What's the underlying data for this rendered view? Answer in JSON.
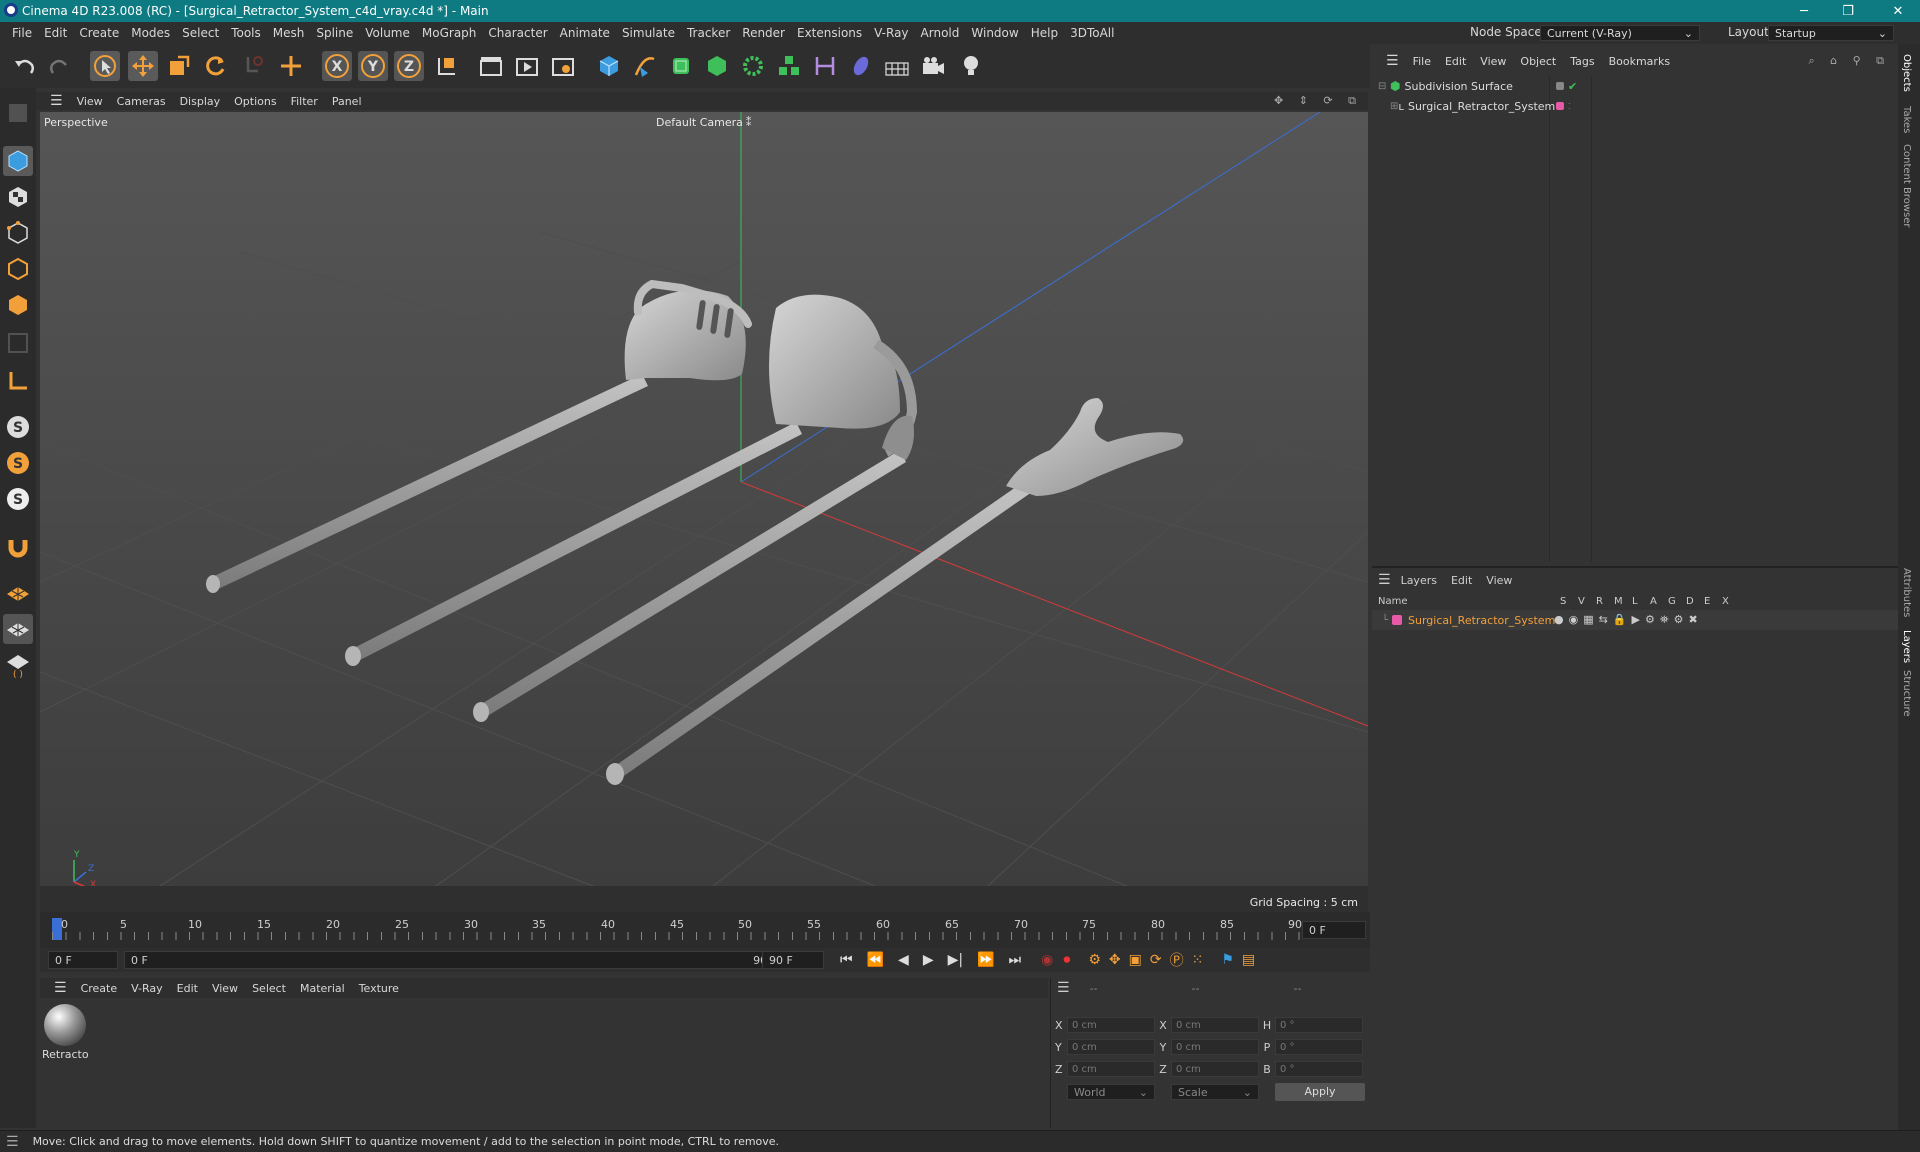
{
  "window": {
    "title": "Cinema 4D R23.008 (RC) - [Surgical_Retractor_System_c4d_vray.c4d *] - Main",
    "minimize": "─",
    "maximize": "❐",
    "close": "✕"
  },
  "menubar": {
    "items": [
      "File",
      "Edit",
      "Create",
      "Modes",
      "Select",
      "Tools",
      "Mesh",
      "Spline",
      "Volume",
      "MoGraph",
      "Character",
      "Animate",
      "Simulate",
      "Tracker",
      "Render",
      "Extensions",
      "V-Ray",
      "Arnold",
      "Window",
      "Help",
      "3DToAll"
    ],
    "node_space_label": "Node Space:",
    "node_space_value": "Current (V-Ray)",
    "layout_label": "Layout:",
    "layout_value": "Startup"
  },
  "viewport": {
    "menu": [
      "View",
      "Cameras",
      "Display",
      "Options",
      "Filter",
      "Panel"
    ],
    "name": "Perspective",
    "camera": "Default Camera",
    "camera_icon": "⁑",
    "grid_spacing": "Grid Spacing : 5 cm",
    "axis_y": "Y",
    "axis_z": "Z",
    "axis_x": "X"
  },
  "timeline": {
    "ticks": [
      "0",
      "5",
      "10",
      "15",
      "20",
      "25",
      "30",
      "35",
      "40",
      "45",
      "50",
      "55",
      "60",
      "65",
      "70",
      "75",
      "80",
      "85",
      "90"
    ],
    "current_frame": "0 F",
    "start": "0 F",
    "range_start": "0 F",
    "range_end": "90 F",
    "end": "90 F"
  },
  "materials": {
    "menu": [
      "Create",
      "V-Ray",
      "Edit",
      "View",
      "Select",
      "Material",
      "Texture"
    ],
    "items": [
      {
        "name": "Retracto"
      }
    ]
  },
  "coords": {
    "headers": [
      "--",
      "--",
      "--"
    ],
    "rows": [
      {
        "l1": "X",
        "v1": "0 cm",
        "l2": "X",
        "v2": "0 cm",
        "l3": "H",
        "v3": "0 °"
      },
      {
        "l1": "Y",
        "v1": "0 cm",
        "l2": "Y",
        "v2": "0 cm",
        "l3": "P",
        "v3": "0 °"
      },
      {
        "l1": "Z",
        "v1": "0 cm",
        "l2": "Z",
        "v2": "0 cm",
        "l3": "B",
        "v3": "0 °"
      }
    ],
    "world": "World",
    "scale": "Scale",
    "apply": "Apply"
  },
  "objects": {
    "menu": [
      "File",
      "Edit",
      "View",
      "Object",
      "Tags",
      "Bookmarks"
    ],
    "items": [
      {
        "name": "Subdivision Surface"
      },
      {
        "name": "Surgical_Retractor_System"
      }
    ]
  },
  "layers": {
    "menu": [
      "Layers",
      "Edit",
      "View"
    ],
    "col_name": "Name",
    "cols": [
      "S",
      "V",
      "R",
      "M",
      "L",
      "A",
      "G",
      "D",
      "E",
      "X"
    ],
    "items": [
      {
        "name": "Surgical_Retractor_System",
        "color": "#e85aa8"
      }
    ]
  },
  "right_tabs": [
    "Objects",
    "Takes",
    "Content Browser",
    "Attributes",
    "Layers",
    "Structure"
  ],
  "status": {
    "text": "Move: Click and drag to move elements. Hold down SHIFT to quantize movement / add to the selection in point mode, CTRL to remove."
  },
  "colors": {
    "accent_orange": "#f2a03a",
    "title_teal": "#0e7a81",
    "layer_text": "#f2a03a",
    "y_axis": "#3fbf5a",
    "z_axis": "#3a6fd6",
    "x_axis": "#d63a3a"
  }
}
